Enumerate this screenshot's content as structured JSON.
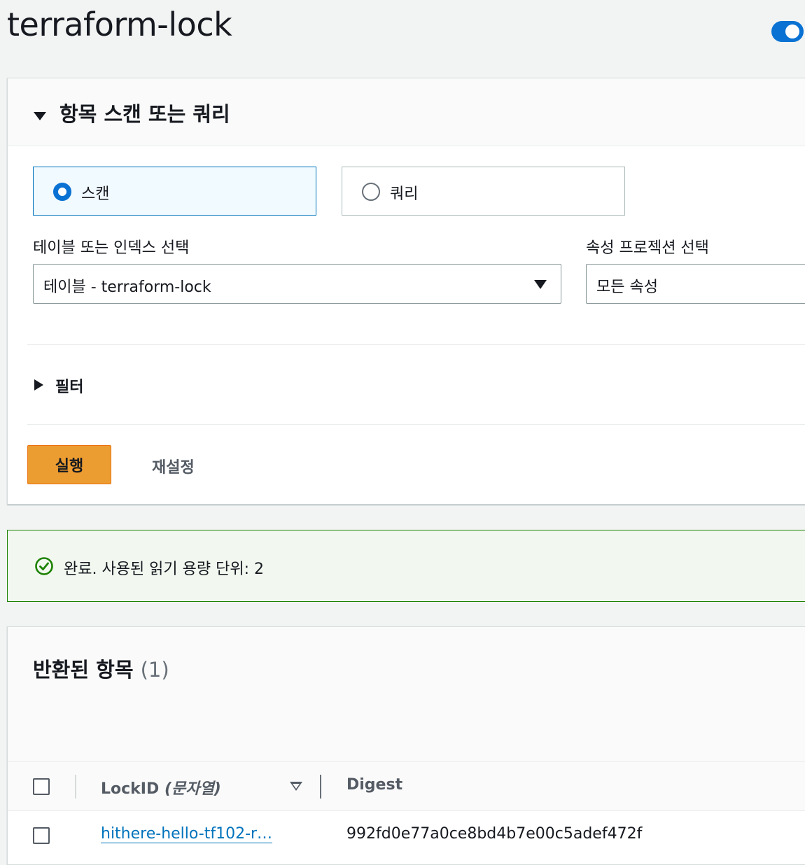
{
  "page": {
    "title": "terraform-lock"
  },
  "scan_panel": {
    "heading": "항목 스캔 또는 쿼리",
    "options": [
      {
        "label": "스캔",
        "selected": true
      },
      {
        "label": "쿼리",
        "selected": false
      }
    ],
    "table_select": {
      "label": "테이블 또는 인덱스 선택",
      "value": "테이블 - terraform-lock"
    },
    "projection_select": {
      "label": "속성 프로젝션 선택",
      "value": "모든 속성"
    },
    "filter_label": "필터",
    "run_label": "실행",
    "reset_label": "재설정"
  },
  "alert": {
    "text": "완료. 사용된 읽기 용량 단위: 2",
    "status_color": "#1d8102"
  },
  "results": {
    "heading": "반환된 항목",
    "count": "(1)",
    "columns": {
      "lockid_name": "LockID",
      "lockid_type": "(문자열)",
      "digest": "Digest"
    },
    "rows": [
      {
        "lockid": "hithere-hello-tf102-r…",
        "digest": "992fd0e77a0ce8bd4b7e00c5adef472f"
      }
    ]
  },
  "colors": {
    "accent": "#0972d3",
    "primary_button": "#ec9d32",
    "link": "#0073bb"
  }
}
